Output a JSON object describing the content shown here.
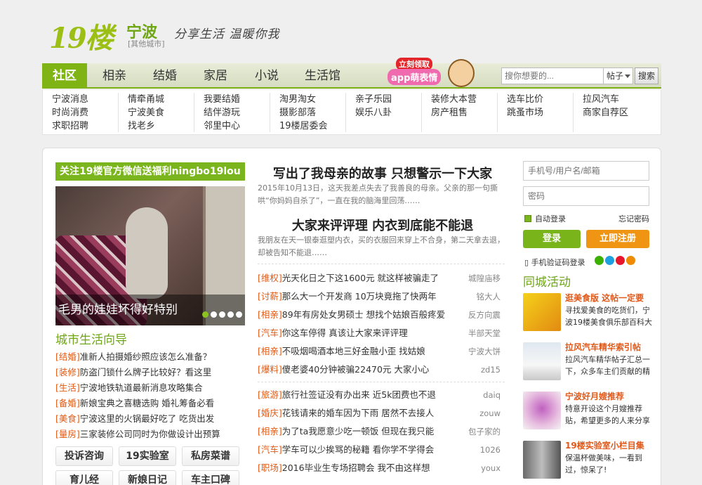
{
  "header": {
    "logo": "19楼",
    "city": "宁波",
    "city_switch": "[其他城市]",
    "slogan": "分享生活 温暖你我"
  },
  "nav": {
    "tabs": [
      "社区",
      "相亲",
      "结婚",
      "家居",
      "小说",
      "生活馆"
    ],
    "promo_badge": "立刻领取",
    "promo_text": "app萌表情",
    "search_placeholder": "搜你想要的...",
    "search_type": "帖子",
    "search_button": "搜索"
  },
  "sublinks": [
    [
      "宁波消息",
      "时尚消费",
      "求职招聘"
    ],
    [
      "情牵甬城",
      "宁波美食",
      "找老乡"
    ],
    [
      "我要结婚",
      "结伴游玩",
      "邻里中心"
    ],
    [
      "淘男淘女",
      "摄影部落",
      "19楼居委会"
    ],
    [
      "亲子乐园",
      "娱乐八卦"
    ],
    [
      "装修大本营",
      "房产租售"
    ],
    [
      "选车比价",
      "跳蚤市场"
    ],
    [
      "拉风汽车",
      "商家自荐区"
    ]
  ],
  "left": {
    "wechat_banner": "关注19楼官方微信送福利ningbo19lou",
    "slide_caption": "毛男的娃娃坏得好特别",
    "guide_title": "城市生活向导",
    "guides": [
      {
        "tag": "[结婚]",
        "text": "准新人拍摄婚纱照应该怎么准备？"
      },
      {
        "tag": "[装修]",
        "text": "防盗门锁什么牌子比较好？看这里"
      },
      {
        "tag": "[生活]",
        "text": "宁波地铁轨道最新消息攻略集合"
      },
      {
        "tag": "[备婚]",
        "text": "新娘宝典之喜糖选购 婚礼筹备必看"
      },
      {
        "tag": "[美食]",
        "text": "宁波这里的火锅最好吃了 吃货出发"
      },
      {
        "tag": "[量房]",
        "text": "三家装修公司同时为你做设计出预算"
      }
    ],
    "tiles": [
      "投诉咨询",
      "19实验室",
      "私房菜谱",
      "育儿经",
      "新娘日记",
      "车主口碑"
    ]
  },
  "middle": {
    "headline1": "写出了我母亲的故事 只想警示一下大家",
    "summary1": "2015年10月13日，这天我差点失去了我善良的母亲。父亲的那一句撕哄“你妈妈自杀了”，一直在我的脑海里回荡……",
    "headline2": "大家来评评理 内衣到底能不能退",
    "summary2": "我朋友在天一银泰逛塑内衣，买的衣服回来穿上不合身，第二天拿去退，却被告知不能退……",
    "posts_a": [
      {
        "tag": "[维权]",
        "title": "光天化日之下这1600元 就这样被骗走了",
        "author": "城隍庙移"
      },
      {
        "tag": "[讨薪]",
        "title": "那么大一个开发商 10万块竟拖了快两年",
        "author": "铭大人"
      },
      {
        "tag": "[相亲]",
        "title": "89年有房处女男硕士 想找个姑娘百般疼爱",
        "author": "反方向震"
      },
      {
        "tag": "[汽车]",
        "title": "你这车停得 真该让大家来评评理",
        "author": "半部天堂"
      },
      {
        "tag": "[相亲]",
        "title": "不吸烟喝酒本地三好金融小歪 找姑娘",
        "author": "宁波大饼"
      },
      {
        "tag": "[爆料]",
        "title": "傻老婆40分钟被骗22470元 大家小心",
        "author": "zd15"
      }
    ],
    "posts_b": [
      {
        "tag": "[旅游]",
        "title": "旅行社签证没有办出来 近5k团费也不退",
        "author": "daiq"
      },
      {
        "tag": "[婚庆]",
        "title": "花钱请来的婚车因为下雨 居然不去接人",
        "author": "zouw"
      },
      {
        "tag": "[相亲]",
        "title": "为了ta我愿意少吃一顿饭 但现在我只能",
        "author": "包子家的"
      },
      {
        "tag": "[汽车]",
        "title": "学车可以少挨骂的秘籍 看你学不学得会",
        "author": "1026"
      },
      {
        "tag": "[职场]",
        "title": "2016毕业生专场招聘会 我不由这样想",
        "author": "youx"
      }
    ]
  },
  "right": {
    "user_placeholder": "手机号/用户名/邮箱",
    "pass_placeholder": "密码",
    "auto_login": "自动登录",
    "forgot": "忘记密码",
    "login": "登录",
    "register": "立即注册",
    "sms_login": "手机验证码登录",
    "events_title": "同城活动",
    "events": [
      {
        "title": "逛美食版 这帖一定要",
        "desc": "寻找爱美食的吃货们，宁波19楼美食俱乐部百科大"
      },
      {
        "title": "拉风汽车精华索引帖",
        "desc": "拉风汽车精华帖子汇总一下，众多车主们贡献的精"
      },
      {
        "title": "宁波好月嫂推荐",
        "desc": "特意开设这个月嫂推荐贴，希望更多的人来分享"
      },
      {
        "title": "19楼实验室小栏目集",
        "desc": "保温杯做美味，一看到过，惊呆了!"
      }
    ]
  },
  "colors": {
    "brand_green": "#80b414",
    "tag_orange": "#e05a15",
    "register_orange": "#f09413"
  }
}
